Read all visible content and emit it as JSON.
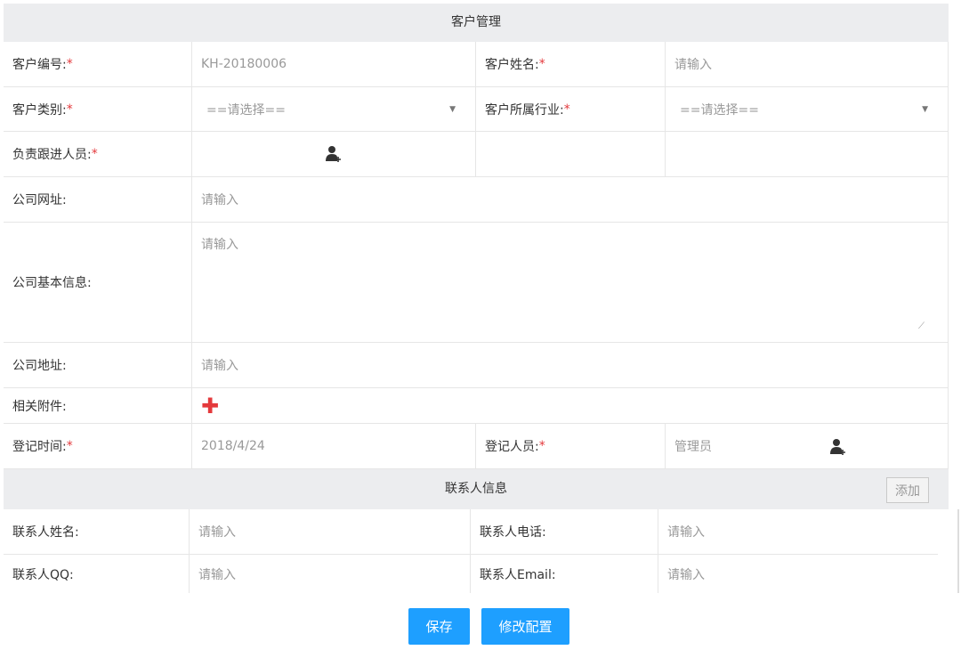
{
  "title": "客户管理",
  "fields": {
    "code": {
      "label": "客户编号:",
      "value": "KH-20180006"
    },
    "name": {
      "label": "客户姓名:",
      "placeholder": "请输入"
    },
    "category": {
      "label": "客户类别:",
      "value": "==请选择=="
    },
    "industry": {
      "label": "客户所属行业:",
      "value": "==请选择=="
    },
    "owner": {
      "label": "负责跟进人员:"
    },
    "website": {
      "label": "公司网址:",
      "placeholder": "请输入"
    },
    "info": {
      "label": "公司基本信息:",
      "placeholder": "请输入"
    },
    "address": {
      "label": "公司地址:",
      "placeholder": "请输入"
    },
    "attachment": {
      "label": "相关附件:"
    },
    "reg_time": {
      "label": "登记时间:",
      "value": "2018/4/24"
    },
    "reg_person": {
      "label": "登记人员:",
      "value": "管理员"
    }
  },
  "required_mark": "*",
  "contacts": {
    "title": "联系人信息",
    "add_label": "添加",
    "name": {
      "label": "联系人姓名:",
      "placeholder": "请输入"
    },
    "phone": {
      "label": "联系人电话:",
      "placeholder": "请输入"
    },
    "qq": {
      "label": "联系人QQ:",
      "placeholder": "请输入"
    },
    "email": {
      "label": "联系人Email:",
      "placeholder": "请输入"
    }
  },
  "buttons": {
    "save": "保存",
    "config": "修改配置"
  },
  "colors": {
    "primary": "#1e9fff",
    "required": "#e4393c",
    "attach": "#e4393c"
  }
}
